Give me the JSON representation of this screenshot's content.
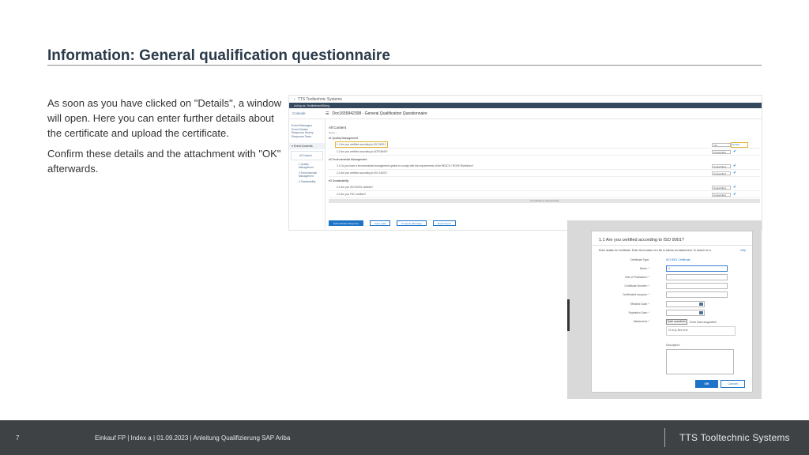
{
  "slide": {
    "title": "Information: General qualification questionnaire",
    "paragraph1": "As soon as you have clicked on \"Details\", a window will open. Here you can enter further details about the certificate and upload the certificate.",
    "paragraph2": "Confirm these details and the attachment with \"OK\" afterwards."
  },
  "ariba": {
    "brand": "TTS Tooltechnic Systems",
    "bar": "Acting as: Testlieferant/Beleg",
    "console": "Console",
    "doc_title": "Doc1659942308 - General Qualification Questionnaire",
    "side_links": [
      "Event Messages",
      "Event Details",
      "Response History",
      "Response Team"
    ],
    "side_group": "Event Contents",
    "side_items": [
      "All Content",
      "1 Quality Management",
      "2 Environmental Management",
      "3 Sustainability"
    ],
    "content_title": "All Content",
    "content_sub": "Name ↑",
    "sections": [
      {
        "label": "1 Quality Management",
        "rows": [
          {
            "q": "1.1 Are you certified according to ISO 9001?",
            "value": "Yes",
            "details": "Details"
          },
          {
            "q": "1.2 Are you certified according to IATF16949?",
            "value": "Unspecified"
          }
        ]
      },
      {
        "label": "2 Environmental Management",
        "rows": [
          {
            "q": "2.1 Do you have a environmental management system to comply with the requirements of the REACH / ROHS Richtlinien?",
            "value": "Unspecified"
          },
          {
            "q": "2.2 Are you certified according to ISO 14001?",
            "value": "Unspecified"
          }
        ]
      },
      {
        "label": "3 Sustainability",
        "rows": [
          {
            "q": "3.1 Are you ISO 50001 certified?",
            "value": "Unspecified"
          },
          {
            "q": "3.2 Are you FSC certified?",
            "value": "Unspecified"
          }
        ]
      }
    ],
    "footer_bar": "(*) indicates a required field",
    "buttons": [
      "Submit Entire Response",
      "Save draft",
      "Compose Message",
      "Excel Import"
    ]
  },
  "dialog": {
    "title": "1.1 Are you certified according to ISO 9001?",
    "intro": "Enter details for Certificate. Enter the location of a file to add as an Attachment. To search for a",
    "help": "Help",
    "cert_type_label": "Certificate Type:",
    "cert_type_value": "ISO 9001 Certificate",
    "fields": [
      "Name: *",
      "Year of Publication: *",
      "Certificate Number: *",
      "Certificated scoopes: *",
      "Effective Date: *",
      "Expiration Date: *"
    ],
    "name_value": "1",
    "attachment_label": "Attachment: *",
    "attach_button": "Datei auswählen",
    "attach_note": "Keine Datei ausgewählt",
    "drop_text": "Or drop files here",
    "description_label": "Description:",
    "ok": "OK",
    "cancel": "Cancel"
  },
  "footer": {
    "page": "7",
    "text": "Einkauf FP | Index a | 01.09.2023 | Anleitung Qualifizierung SAP Ariba",
    "brand": "TTS Tooltechnic Systems"
  },
  "colors": {
    "accent": "#1c73c7",
    "highlight": "#e2b530",
    "footer_bg": "#3f4245",
    "title": "#2b3a4a"
  }
}
